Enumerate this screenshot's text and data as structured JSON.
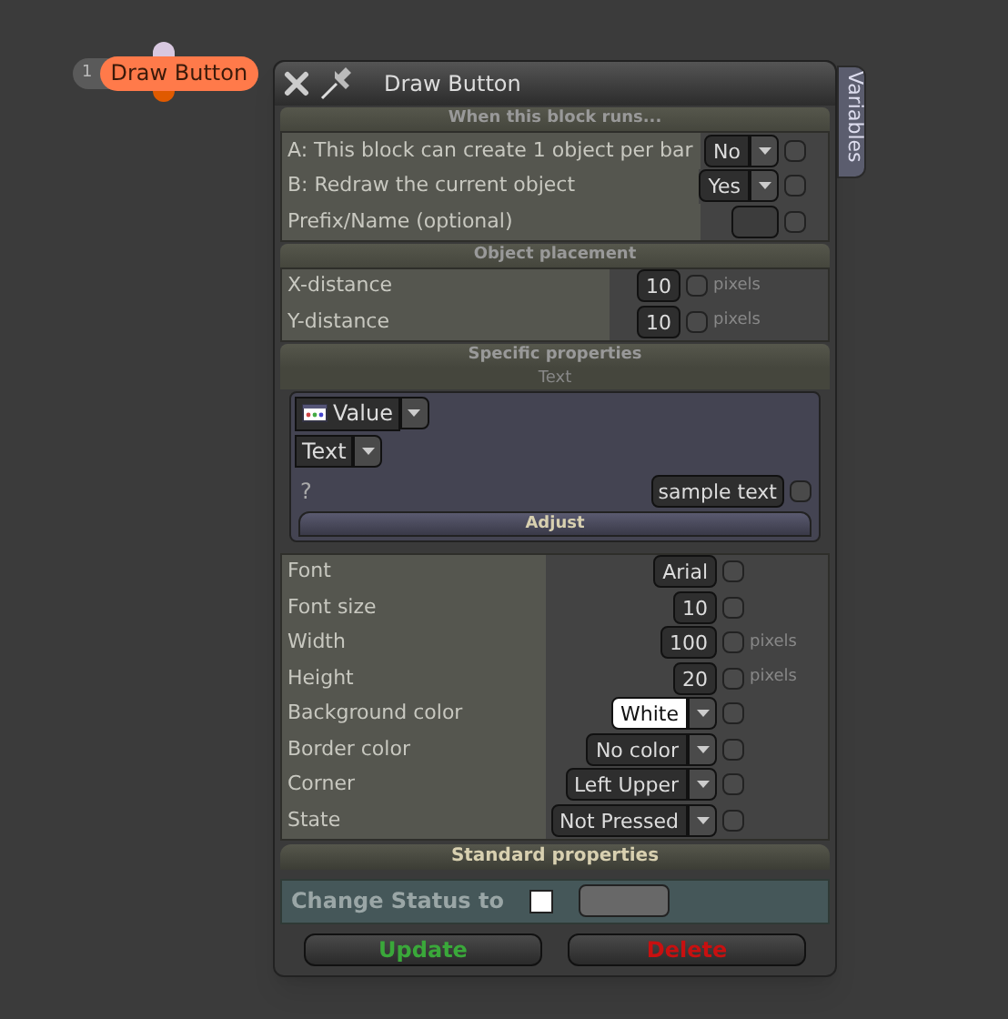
{
  "node": {
    "number": "1",
    "label": "Draw Button"
  },
  "window": {
    "title": "Draw Button",
    "side_tab": "Variables"
  },
  "run_section": {
    "title": "When this block runs...",
    "rows": [
      {
        "label": "A: This block can create 1 object per bar",
        "kind": "dropdown",
        "value": "No",
        "checked": false
      },
      {
        "label": "B: Redraw the current object",
        "kind": "dropdown",
        "value": "Yes",
        "checked": false
      },
      {
        "label": "Prefix/Name (optional)",
        "kind": "field",
        "checked": false
      }
    ]
  },
  "placement_section": {
    "title": "Object placement",
    "rows": [
      {
        "label": "X-distance",
        "kind": "field",
        "value": "10",
        "checked": false,
        "unit": "pixels"
      },
      {
        "label": "Y-distance",
        "kind": "field",
        "value": "10",
        "checked": false,
        "unit": "pixels"
      }
    ]
  },
  "specific_section": {
    "title": "Specific properties",
    "subtitle": "Text",
    "source": "Value",
    "type": "Text",
    "question": "?",
    "text_value": "sample text",
    "text_checked": false,
    "adjust": "Adjust",
    "rows": [
      {
        "label": "Font",
        "kind": "field",
        "value": "Arial",
        "checked": false
      },
      {
        "label": "Font size",
        "kind": "field",
        "value": "10",
        "checked": false
      },
      {
        "label": "Width",
        "kind": "field",
        "value": "100",
        "checked": false,
        "unit": "pixels"
      },
      {
        "label": "Height",
        "kind": "field",
        "value": "20",
        "checked": false,
        "unit": "pixels"
      },
      {
        "label": "Background color",
        "kind": "dropdown",
        "value": "White",
        "color": "#ffffff",
        "checked": false
      },
      {
        "label": "Border color",
        "kind": "dropdown",
        "value": "No color",
        "checked": false
      },
      {
        "label": "Corner",
        "kind": "dropdown",
        "value": "Left Upper",
        "checked": false
      },
      {
        "label": "State",
        "kind": "dropdown",
        "value": "Not Pressed",
        "checked": false
      }
    ]
  },
  "standard_section": {
    "title": "Standard properties",
    "status_label": "Change Status to",
    "status_checked": false
  },
  "buttons": [
    {
      "label": "Update",
      "kind": "update"
    },
    {
      "label": "Delete",
      "kind": "delete"
    }
  ]
}
